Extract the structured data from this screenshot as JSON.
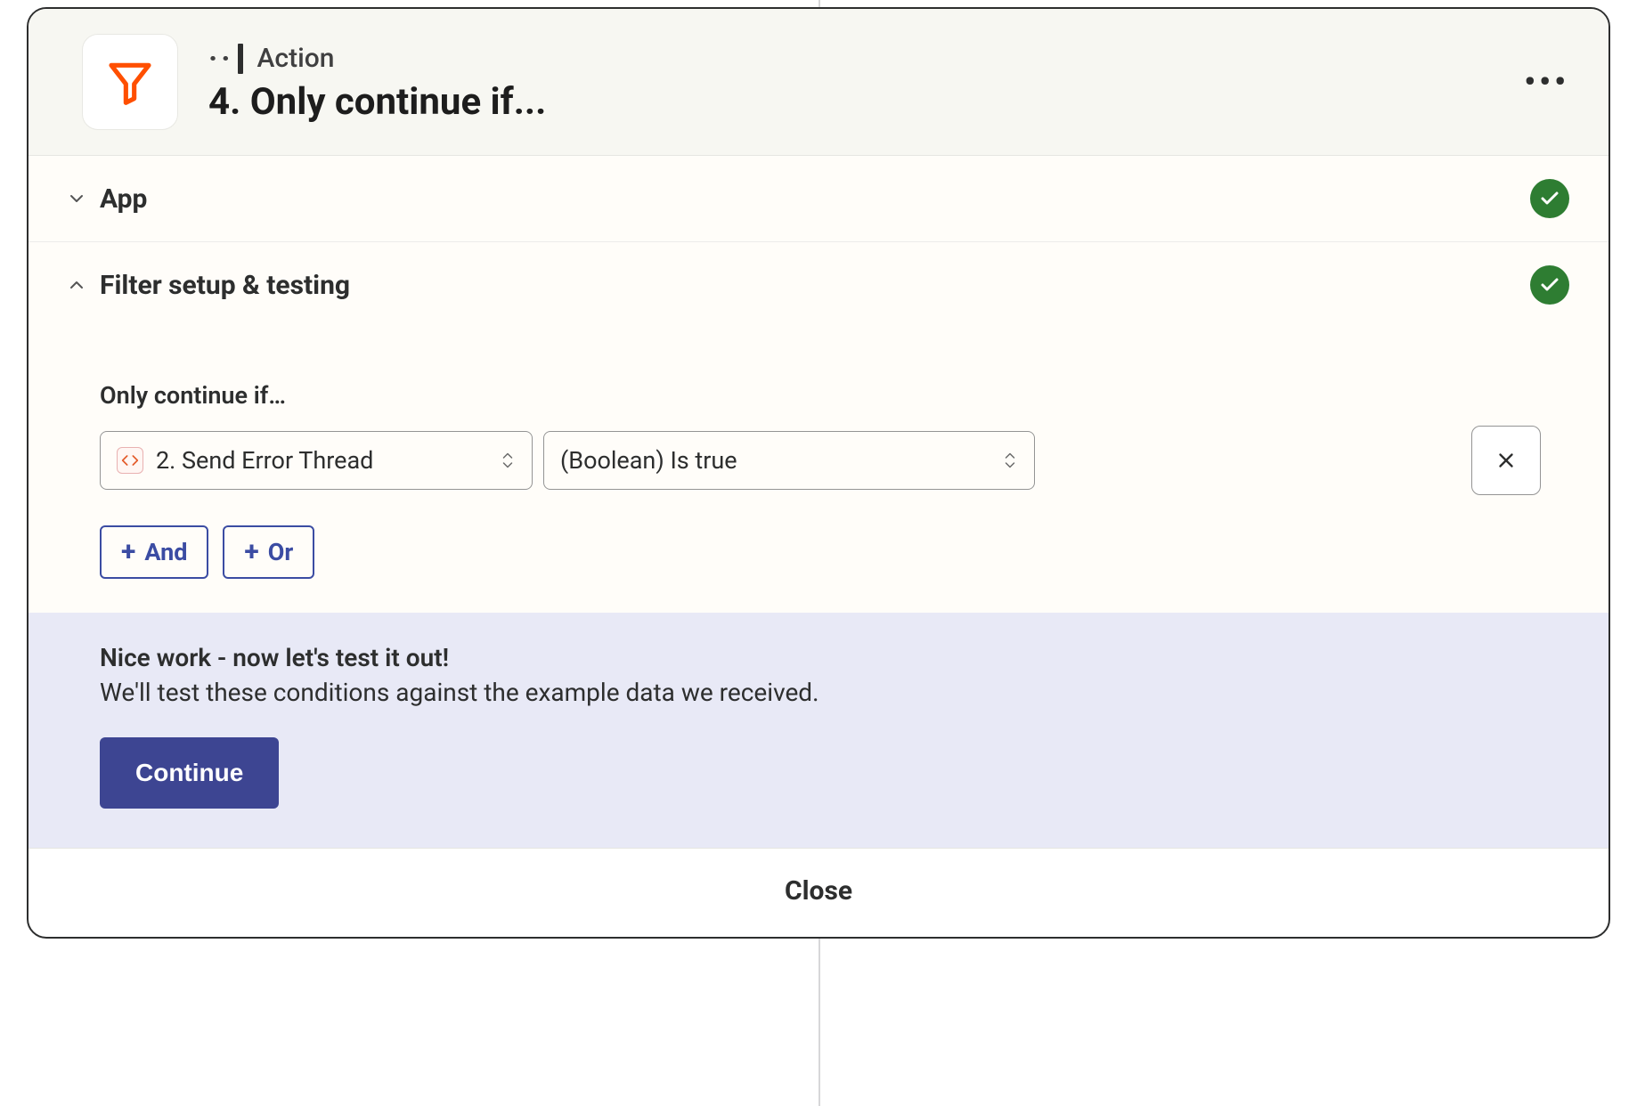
{
  "header": {
    "type_label": "Action",
    "step_title": "4. Only continue if..."
  },
  "sections": {
    "app": {
      "title": "App"
    },
    "filter": {
      "title": "Filter setup & testing"
    }
  },
  "condition": {
    "label": "Only continue if…",
    "lhs": "2. Send Error Thread",
    "rhs": "(Boolean) Is true"
  },
  "logic": {
    "and_label": "And",
    "or_label": "Or"
  },
  "test": {
    "heading": "Nice work - now let's test it out!",
    "subtext": "We'll test these conditions against the example data we received.",
    "continue_label": "Continue"
  },
  "footer": {
    "close_label": "Close"
  }
}
